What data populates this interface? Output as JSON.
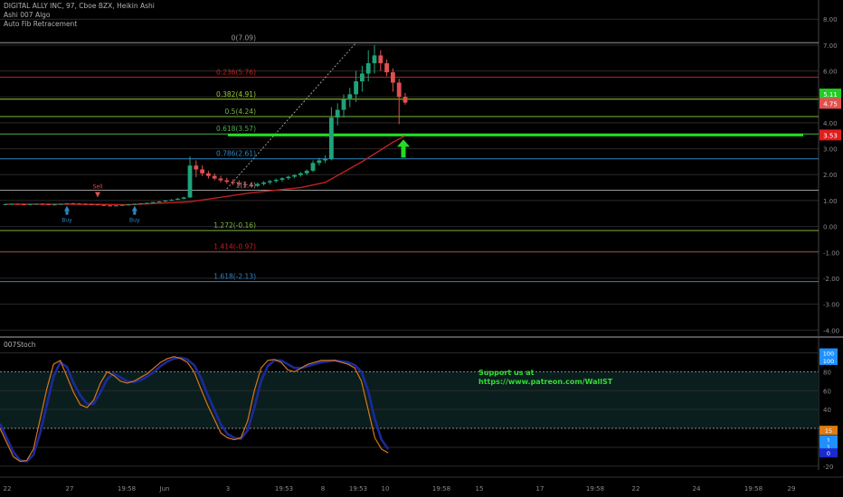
{
  "header": {
    "title": "DIGITAL ALLY INC, 97, Cboe BZX, Heikin Ashi",
    "indicator_1": "Ashi 007 Algo",
    "indicator_2": "Auto Fib Retracement"
  },
  "oscillator": {
    "title": "007Stoch"
  },
  "promo": {
    "line1": "Support us at",
    "line2": "https://www.patreon.com/WallST"
  },
  "colors": {
    "background": "#000000",
    "up_candle": "#1fa37a",
    "down_candle": "#e2504f",
    "moving_average": "#c0201e",
    "support_line": "#22dd22",
    "stoch_k": "#d4781c",
    "stoch_d": "#1a2a9a"
  },
  "chart_data": [
    {
      "type": "candlestick",
      "y_ticks": [
        "8.00",
        "7.00",
        "6.00",
        "5.00",
        "4.00",
        "3.00",
        "2.00",
        "1.00",
        "0.00",
        "-1.00",
        "-2.00",
        "-3.00",
        "-4.00"
      ],
      "ylim": [
        -4.2,
        8.6
      ],
      "x_ticks": [
        "22",
        "27",
        "19:58",
        "Jun",
        "3",
        "19:53",
        "8",
        "19:53",
        "10",
        "19:58",
        "15",
        "17",
        "19:58",
        "22",
        "24",
        "19:58",
        "29"
      ],
      "price_labels": [
        {
          "value": 5.11,
          "text": "5.11",
          "color": "#22cc22"
        },
        {
          "value": 4.75,
          "text": "4.75",
          "color": "#e2504f"
        },
        {
          "value": 3.53,
          "text": "3.53",
          "color": "#e01e1e"
        }
      ],
      "fib_levels": [
        {
          "ratio": "0",
          "price": 7.09,
          "label": "0(7.09)",
          "color": "#999999"
        },
        {
          "ratio": "0.236",
          "price": 5.76,
          "label": "0.236(5.76)",
          "color": "#c0201e"
        },
        {
          "ratio": "0.382",
          "price": 4.91,
          "label": "0.382(4.91)",
          "color": "#9acd32"
        },
        {
          "ratio": "0.5",
          "price": 4.24,
          "label": "0.5(4.24)",
          "color": "#7cb342"
        },
        {
          "ratio": "0.618",
          "price": 3.57,
          "label": "0.618(3.57)",
          "color": "#4caf50"
        },
        {
          "ratio": "0.786",
          "price": 2.61,
          "label": "0.786(2.61)",
          "color": "#2e86c1"
        },
        {
          "ratio": "1",
          "price": 1.4,
          "label": "1(1.4)",
          "color": "#999999"
        },
        {
          "ratio": "1.272",
          "price": -0.16,
          "label": "1.272(-0.16)",
          "color": "#7cb342"
        },
        {
          "ratio": "1.414",
          "price": -0.97,
          "label": "1.414(-0.97)",
          "color": "#c0201e"
        },
        {
          "ratio": "1.618",
          "price": -2.13,
          "label": "1.618(-2.13)",
          "color": "#2e86c1"
        }
      ],
      "support_level": 3.53,
      "signals": [
        {
          "type": "Sell",
          "bar": 15,
          "price": 1.12
        },
        {
          "type": "Buy",
          "bar": 10,
          "price": 0.8
        },
        {
          "type": "Buy",
          "bar": 21,
          "price": 0.8
        }
      ],
      "candles": [
        [
          0.86,
          0.88,
          0.84,
          0.86
        ],
        [
          0.86,
          0.88,
          0.84,
          0.87
        ],
        [
          0.87,
          0.88,
          0.85,
          0.86
        ],
        [
          0.86,
          0.87,
          0.84,
          0.85
        ],
        [
          0.85,
          0.87,
          0.84,
          0.86
        ],
        [
          0.86,
          0.88,
          0.85,
          0.87
        ],
        [
          0.87,
          0.89,
          0.85,
          0.86
        ],
        [
          0.86,
          0.87,
          0.83,
          0.84
        ],
        [
          0.84,
          0.86,
          0.82,
          0.85
        ],
        [
          0.85,
          0.88,
          0.84,
          0.87
        ],
        [
          0.87,
          0.9,
          0.85,
          0.89
        ],
        [
          0.89,
          0.91,
          0.87,
          0.88
        ],
        [
          0.88,
          0.9,
          0.86,
          0.87
        ],
        [
          0.87,
          0.89,
          0.85,
          0.86
        ],
        [
          0.86,
          0.88,
          0.84,
          0.85
        ],
        [
          0.85,
          0.87,
          0.82,
          0.83
        ],
        [
          0.83,
          0.85,
          0.8,
          0.81
        ],
        [
          0.81,
          0.83,
          0.79,
          0.8
        ],
        [
          0.8,
          0.82,
          0.78,
          0.81
        ],
        [
          0.81,
          0.84,
          0.8,
          0.83
        ],
        [
          0.83,
          0.86,
          0.82,
          0.85
        ],
        [
          0.85,
          0.88,
          0.84,
          0.87
        ],
        [
          0.87,
          0.9,
          0.86,
          0.89
        ],
        [
          0.89,
          0.92,
          0.88,
          0.91
        ],
        [
          0.91,
          0.95,
          0.9,
          0.94
        ],
        [
          0.94,
          0.98,
          0.93,
          0.96
        ],
        [
          0.96,
          1.02,
          0.95,
          1.0
        ],
        [
          1.0,
          1.05,
          0.98,
          1.03
        ],
        [
          1.03,
          1.1,
          1.02,
          1.07
        ],
        [
          1.07,
          1.14,
          1.05,
          1.12
        ],
        [
          1.12,
          2.7,
          1.1,
          2.35
        ],
        [
          2.35,
          2.55,
          1.9,
          2.2
        ],
        [
          2.2,
          2.35,
          1.95,
          2.05
        ],
        [
          2.05,
          2.15,
          1.85,
          1.95
        ],
        [
          1.95,
          2.05,
          1.78,
          1.85
        ],
        [
          1.85,
          1.95,
          1.7,
          1.78
        ],
        [
          1.78,
          1.88,
          1.65,
          1.72
        ],
        [
          1.72,
          1.82,
          1.6,
          1.68
        ],
        [
          1.68,
          1.78,
          1.55,
          1.63
        ],
        [
          1.63,
          1.74,
          1.52,
          1.6
        ],
        [
          1.6,
          1.7,
          1.5,
          1.57
        ],
        [
          1.57,
          1.69,
          1.52,
          1.64
        ],
        [
          1.64,
          1.75,
          1.58,
          1.7
        ],
        [
          1.7,
          1.8,
          1.62,
          1.75
        ],
        [
          1.75,
          1.85,
          1.68,
          1.8
        ],
        [
          1.8,
          1.9,
          1.72,
          1.86
        ],
        [
          1.86,
          1.96,
          1.8,
          1.92
        ],
        [
          1.92,
          2.02,
          1.86,
          1.98
        ],
        [
          1.98,
          2.1,
          1.92,
          2.05
        ],
        [
          2.05,
          2.2,
          1.98,
          2.15
        ],
        [
          2.15,
          2.55,
          2.1,
          2.45
        ],
        [
          2.45,
          2.65,
          2.35,
          2.55
        ],
        [
          2.55,
          2.75,
          2.45,
          2.6
        ],
        [
          2.6,
          4.6,
          2.55,
          4.2
        ],
        [
          4.2,
          4.75,
          3.9,
          4.5
        ],
        [
          4.5,
          5.1,
          4.2,
          4.9
        ],
        [
          4.9,
          5.35,
          4.6,
          5.1
        ],
        [
          5.1,
          6.0,
          4.8,
          5.6
        ],
        [
          5.6,
          6.2,
          5.2,
          5.9
        ],
        [
          5.9,
          6.8,
          5.6,
          6.3
        ],
        [
          6.3,
          7.0,
          5.9,
          6.6
        ],
        [
          6.6,
          6.8,
          6.0,
          6.3
        ],
        [
          6.3,
          6.45,
          5.8,
          5.95
        ],
        [
          5.95,
          6.1,
          5.2,
          5.55
        ],
        [
          5.55,
          5.7,
          3.95,
          5.0
        ],
        [
          5.0,
          5.15,
          4.7,
          4.78
        ]
      ],
      "moving_average": [
        [
          0,
          0.86
        ],
        [
          10,
          0.86
        ],
        [
          20,
          0.84
        ],
        [
          30,
          0.95
        ],
        [
          40,
          1.3
        ],
        [
          48,
          1.5
        ],
        [
          52,
          1.7
        ],
        [
          55,
          2.1
        ],
        [
          58,
          2.5
        ],
        [
          61,
          2.95
        ],
        [
          63,
          3.25
        ],
        [
          65,
          3.5
        ]
      ]
    },
    {
      "type": "line",
      "title": "007Stoch",
      "y_ticks": [
        "100",
        "80",
        "60",
        "40",
        "20",
        "0",
        "-20"
      ],
      "ylim": [
        -24,
        112
      ],
      "axis_labels": [
        {
          "value": 100,
          "text": "100",
          "color": "#1e90ff"
        },
        {
          "value": 92,
          "text": "100",
          "color": "#1e90ff"
        },
        {
          "value": 18,
          "text": "15",
          "color": "#e07b12"
        },
        {
          "value": 8,
          "text": "1",
          "color": "#1e90ff"
        },
        {
          "value": 1,
          "text": "1",
          "color": "#1e90ff"
        },
        {
          "value": -6,
          "text": "0",
          "color": "#1a2acc"
        }
      ],
      "series": [
        {
          "values": [
            20,
            5,
            -10,
            -15,
            -14,
            -2,
            30,
            62,
            88,
            92,
            75,
            58,
            45,
            42,
            50,
            68,
            80,
            76,
            70,
            68,
            70,
            74,
            78,
            84,
            90,
            94,
            96,
            94,
            90,
            80,
            62,
            45,
            30,
            15,
            10,
            8,
            10,
            28,
            60,
            84,
            92,
            93,
            90,
            82,
            80,
            84,
            88,
            90,
            92,
            92,
            92,
            90,
            88,
            84,
            70,
            40,
            10,
            -2,
            -6
          ]
        },
        {
          "values": [
            25,
            10,
            -5,
            -14,
            -15,
            -8,
            15,
            45,
            75,
            90,
            85,
            68,
            55,
            46,
            46,
            58,
            72,
            78,
            74,
            70,
            69,
            71,
            75,
            80,
            86,
            91,
            94,
            95,
            93,
            87,
            74,
            56,
            40,
            24,
            14,
            10,
            9,
            18,
            42,
            70,
            86,
            92,
            92,
            88,
            84,
            84,
            86,
            88,
            90,
            91,
            92,
            91,
            90,
            87,
            80,
            60,
            30,
            8,
            -2
          ]
        }
      ]
    }
  ]
}
